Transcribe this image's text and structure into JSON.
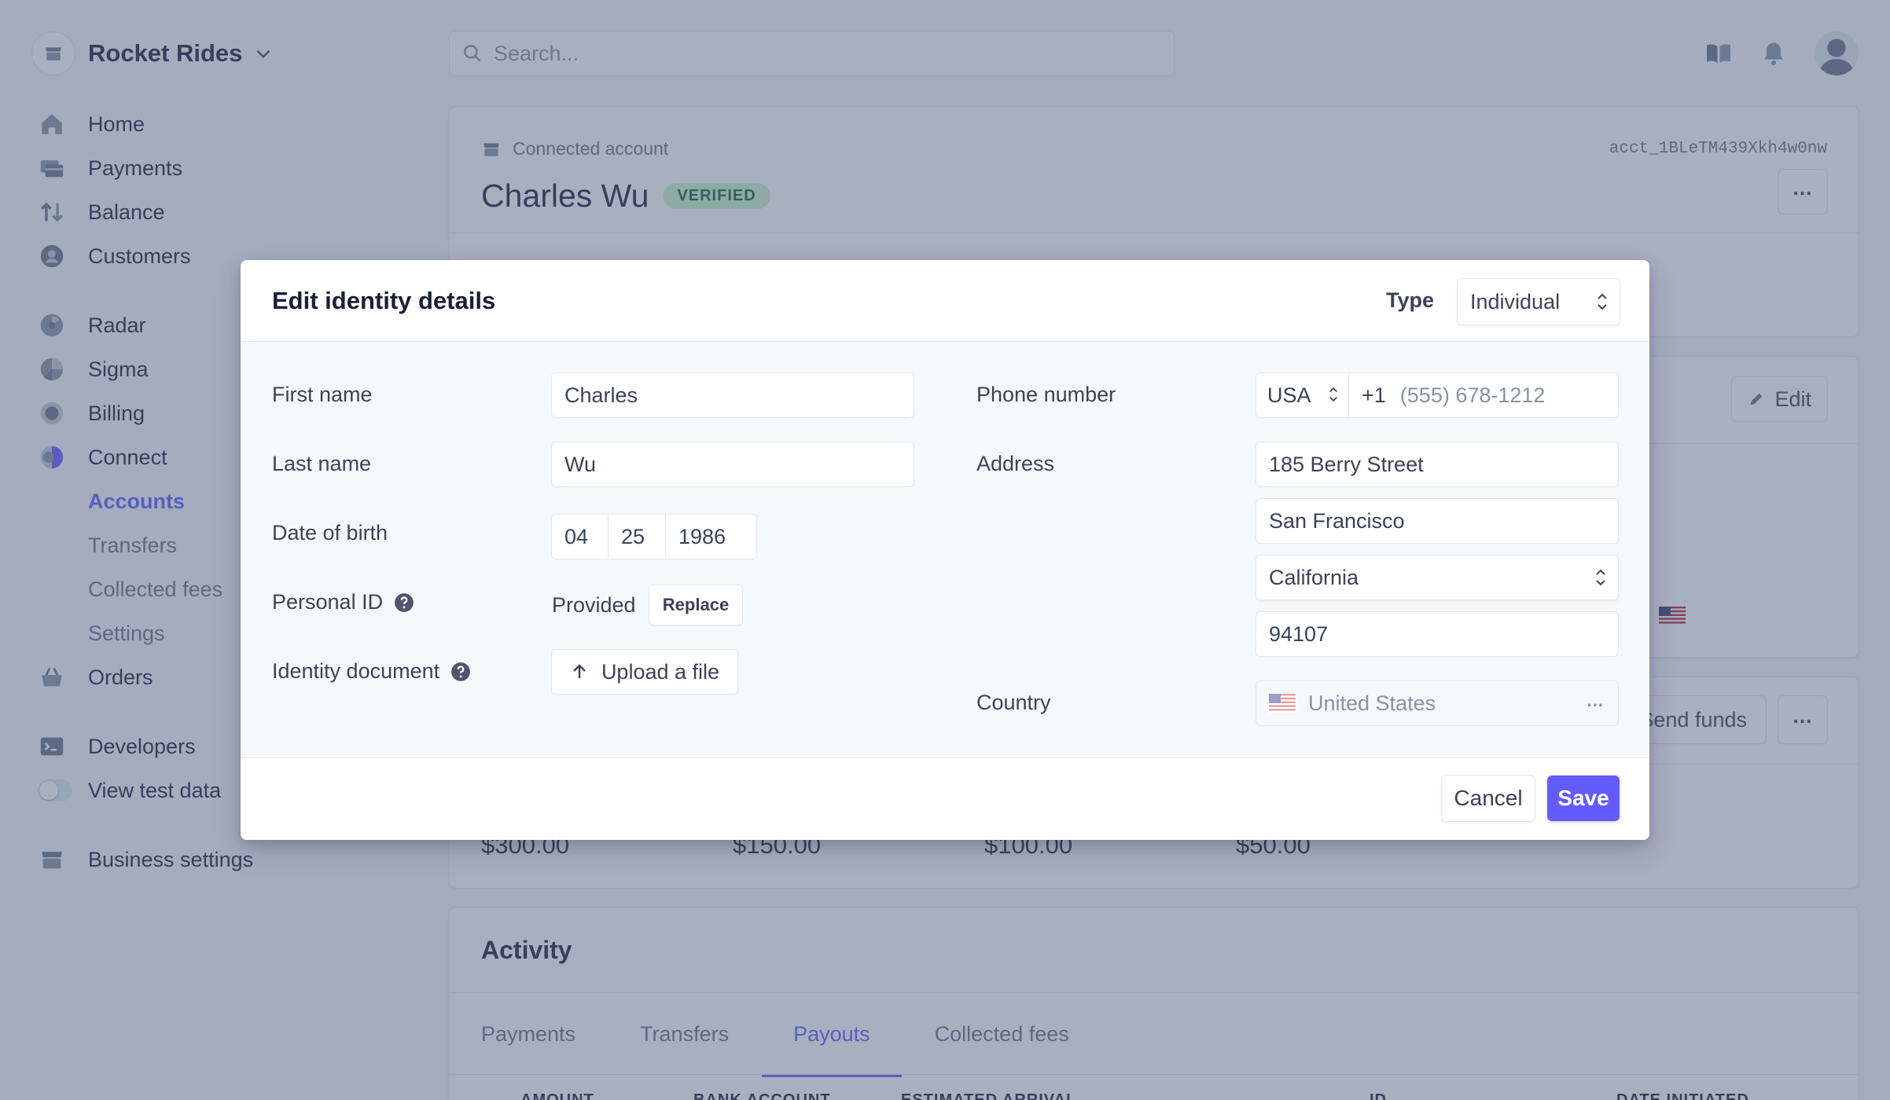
{
  "brand": {
    "name": "Rocket Rides"
  },
  "search": {
    "placeholder": "Search..."
  },
  "sidebar": {
    "primary": [
      {
        "label": "Home",
        "icon": "home-icon"
      },
      {
        "label": "Payments",
        "icon": "payments-icon"
      },
      {
        "label": "Balance",
        "icon": "balance-icon"
      },
      {
        "label": "Customers",
        "icon": "customers-icon"
      }
    ],
    "products": [
      {
        "label": "Radar",
        "icon": "radar-icon"
      },
      {
        "label": "Sigma",
        "icon": "sigma-icon"
      },
      {
        "label": "Billing",
        "icon": "billing-icon"
      },
      {
        "label": "Connect",
        "icon": "connect-icon"
      }
    ],
    "connect_sub": [
      {
        "label": "Accounts",
        "active": true
      },
      {
        "label": "Transfers",
        "active": false
      },
      {
        "label": "Collected fees",
        "active": false
      },
      {
        "label": "Settings",
        "active": false
      }
    ],
    "orders": {
      "label": "Orders",
      "icon": "orders-icon"
    },
    "developers": {
      "label": "Developers",
      "icon": "developers-icon"
    },
    "test_data": {
      "label": "View test data",
      "enabled": false
    },
    "business_settings": {
      "label": "Business settings",
      "icon": "business-settings-icon"
    }
  },
  "account": {
    "section_label": "Connected account",
    "id": "acct_1BLeTM439Xkh4w0nw",
    "name": "Charles Wu",
    "status": "VERIFIED"
  },
  "details_card": {
    "edit_label": "Edit"
  },
  "balance_card": {
    "send_funds_label": "Send funds",
    "amounts": [
      "$300.00",
      "$150.00",
      "$100.00",
      "$50.00"
    ]
  },
  "activity": {
    "title": "Activity",
    "tabs": [
      {
        "label": "Payments",
        "active": false
      },
      {
        "label": "Transfers",
        "active": false
      },
      {
        "label": "Payouts",
        "active": true
      },
      {
        "label": "Collected fees",
        "active": false
      }
    ],
    "columns": [
      "AMOUNT",
      "BANK ACCOUNT",
      "ESTIMATED ARRIVAL",
      "ID",
      "DATE INITIATED"
    ]
  },
  "modal": {
    "title": "Edit identity details",
    "type_label": "Type",
    "type_value": "Individual",
    "first_name": {
      "label": "First name",
      "value": "Charles"
    },
    "last_name": {
      "label": "Last name",
      "value": "Wu"
    },
    "dob": {
      "label": "Date of birth",
      "month": "04",
      "day": "25",
      "year": "1986"
    },
    "personal_id": {
      "label": "Personal ID",
      "status": "Provided",
      "replace_label": "Replace"
    },
    "identity_document": {
      "label": "Identity document",
      "upload_label": "Upload a file"
    },
    "phone": {
      "label": "Phone number",
      "country_code": "USA",
      "prefix": "+1",
      "placeholder": "(555) 678-1212"
    },
    "address": {
      "label": "Address",
      "line1": "185 Berry Street",
      "city": "San Francisco",
      "state": "California",
      "zip": "94107"
    },
    "country": {
      "label": "Country",
      "value": "United States"
    },
    "cancel_label": "Cancel",
    "save_label": "Save"
  },
  "colors": {
    "accent": "#635bff",
    "verified_bg": "#cbf4c9",
    "verified_text": "#0e6245"
  }
}
